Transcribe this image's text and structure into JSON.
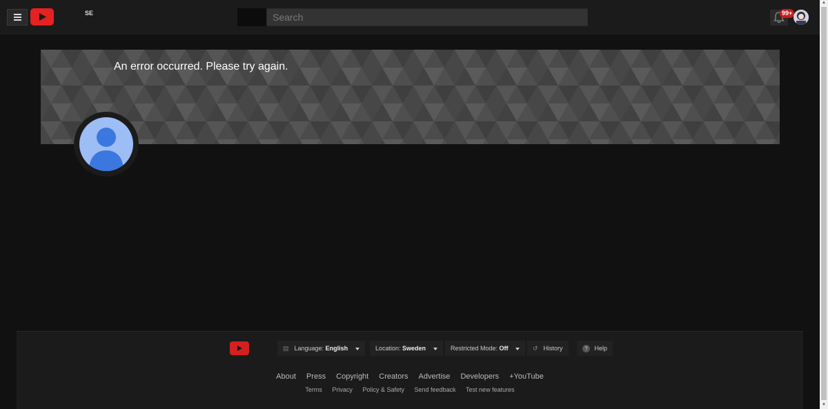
{
  "header": {
    "region": "SE",
    "search_placeholder": "Search",
    "notification_count": "99+"
  },
  "banner": {
    "error_message": "An error occurred. Please try again."
  },
  "footer": {
    "language_label": "Language:",
    "language_value": "English",
    "location_label": "Location:",
    "location_value": "Sweden",
    "restricted_label": "Restricted Mode:",
    "restricted_value": "Off",
    "history": "History",
    "help": "Help",
    "primary_links": [
      "About",
      "Press",
      "Copyright",
      "Creators",
      "Advertise",
      "Developers",
      "+YouTube"
    ],
    "secondary_links": [
      "Terms",
      "Privacy",
      "Policy & Safety",
      "Send feedback",
      "Test new features"
    ]
  },
  "colors": {
    "brand_red": "#e52121",
    "masthead": "#1b1b1b",
    "page_bg": "#111111",
    "avatar_blue": "#9dbdf5"
  }
}
